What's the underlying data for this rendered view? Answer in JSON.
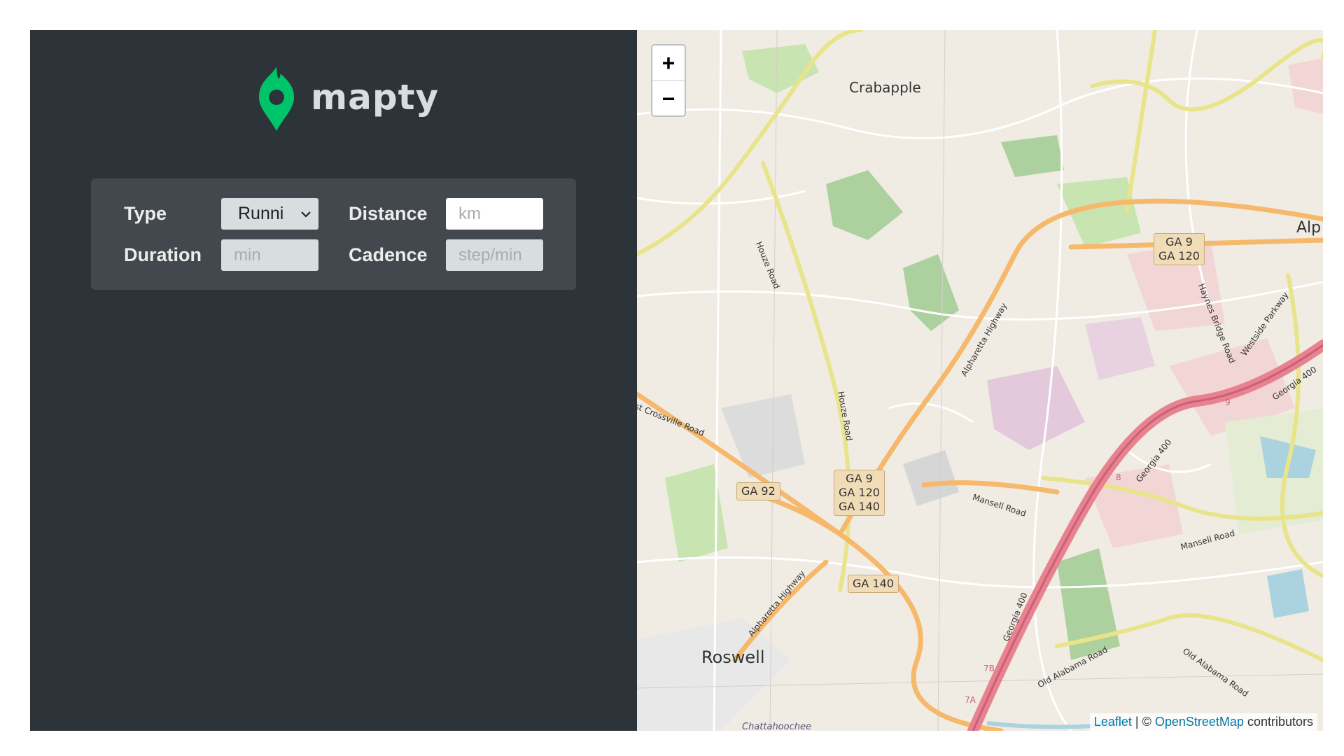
{
  "logo": {
    "icon": "map-pin-icon",
    "text": "mapty",
    "color": "#00c46a"
  },
  "form": {
    "type_label": "Type",
    "type_value": "Runni",
    "distance_label": "Distance",
    "distance_placeholder": "km",
    "duration_label": "Duration",
    "duration_placeholder": "min",
    "cadence_label": "Cadence",
    "cadence_placeholder": "step/min"
  },
  "map": {
    "zoom_in": "+",
    "zoom_out": "−",
    "labels": {
      "crabapple": "Crabapple",
      "roswell": "Roswell",
      "alp": "Alp",
      "chattahoochee": "Chattahoochee",
      "houze1": "Houze Road",
      "houze2": "Houze Road",
      "crossville": "st Crossville Road",
      "alpharetta1": "Alpharetta Highway",
      "alpharetta2": "Alpharetta Highway",
      "haynes": "Haynes Bridge Road",
      "westside": "Westside Parkway",
      "georgia1": "Georgia 400",
      "georgia2": "Georgia 400",
      "georgia3": "Georgia 400",
      "mansell1": "Mansell Road",
      "mansell2": "Mansell Road",
      "oldalabama1": "Old Alabama Road",
      "oldalabama2": "Old Alabama Road",
      "exit9": "9",
      "exit8": "8",
      "exit7b": "7B",
      "exit7a": "7A"
    },
    "shields": {
      "ga9_120_a": "GA 9",
      "ga9_120_b": "GA 120",
      "ga92": "GA 92",
      "ga9_120_140_a": "GA 9",
      "ga9_120_140_b": "GA 120",
      "ga9_120_140_c": "GA 140",
      "ga140": "GA 140"
    },
    "attribution_leaflet": "Leaflet",
    "attribution_sep": "| ©",
    "attribution_osm": "OpenStreetMap",
    "attribution_contrib": "contributors"
  }
}
